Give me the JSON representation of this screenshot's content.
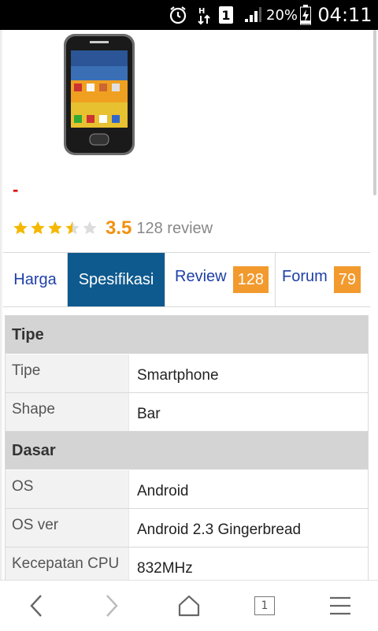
{
  "status_bar": {
    "sim_slot": "1",
    "battery_percent": "20%",
    "time": "04:11",
    "icons": [
      "alarm-icon",
      "data-transfer-icon",
      "sim-icon",
      "signal-icon",
      "battery-charging-icon"
    ]
  },
  "product": {
    "price": "-",
    "rating": {
      "stars": 3.5,
      "score": "3.5",
      "reviews": "128 review"
    }
  },
  "tabs": [
    {
      "label": "Harga",
      "active": false
    },
    {
      "label": "Spesifikasi",
      "active": true
    },
    {
      "label": "Review",
      "badge": "128",
      "active": false
    },
    {
      "label": "Forum",
      "badge": "79",
      "active": false
    }
  ],
  "spec": {
    "sections": [
      {
        "title": "Tipe",
        "rows": [
          {
            "label": "Tipe",
            "value": "Smartphone"
          },
          {
            "label": "Shape",
            "value": "Bar"
          }
        ]
      },
      {
        "title": "Dasar",
        "rows": [
          {
            "label": "OS",
            "value": "Android"
          },
          {
            "label": "OS ver",
            "value": "Android 2.3 Gingerbread"
          },
          {
            "label": "Kecepatan CPU",
            "value": "832MHz"
          }
        ]
      }
    ]
  },
  "nav": {
    "tab_count": "1"
  },
  "colors": {
    "accent_tab": "#0e5a8e",
    "badge": "#f29a2e",
    "star": "#f5b800",
    "score": "#f29111",
    "price": "#e00000",
    "link": "#1e3fa8"
  }
}
